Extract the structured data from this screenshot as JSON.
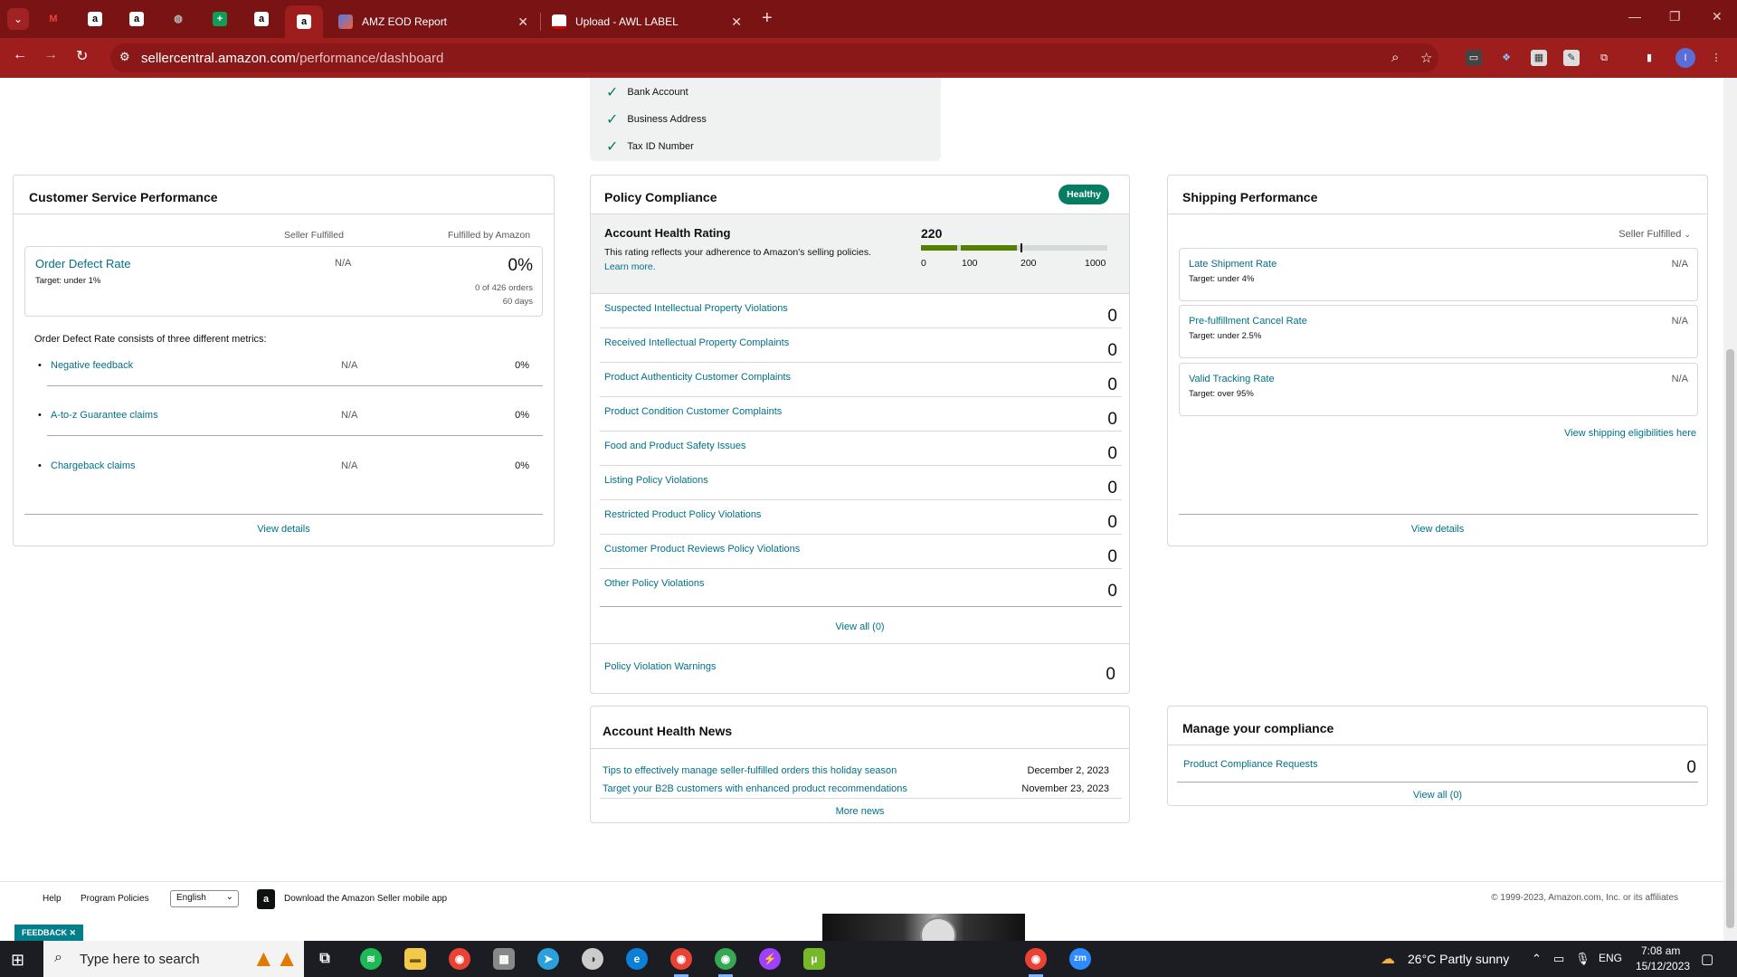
{
  "browser": {
    "tabs": [
      {
        "title": "AMZ EOD Report"
      },
      {
        "title": "Upload - AWL LABEL"
      }
    ],
    "url_host": "sellercentral.amazon.com",
    "url_path": "/performance/dashboard"
  },
  "verification": {
    "items": [
      "Bank Account",
      "Business Address",
      "Tax ID Number"
    ]
  },
  "customer_service": {
    "title": "Customer Service Performance",
    "col_seller": "Seller Fulfilled",
    "col_amazon": "Fulfilled by Amazon",
    "odr": {
      "label": "Order Defect Rate",
      "target": "Target: under 1%",
      "seller_value": "N/A",
      "amazon_value": "0%",
      "amazon_orders": "0 of 426 orders",
      "amazon_period": "60 days"
    },
    "consists_text": "Order Defect Rate consists of three different metrics:",
    "metrics": [
      {
        "label": "Negative feedback",
        "seller": "N/A",
        "amazon": "0%"
      },
      {
        "label": "A-to-z Guarantee claims",
        "seller": "N/A",
        "amazon": "0%"
      },
      {
        "label": "Chargeback claims",
        "seller": "N/A",
        "amazon": "0%"
      }
    ],
    "view_details": "View details"
  },
  "policy": {
    "title": "Policy Compliance",
    "badge": "Healthy",
    "ahr_title": "Account Health Rating",
    "ahr_desc": "This rating reflects your adherence to Amazon's selling policies.",
    "learn_more": "Learn more.",
    "score": "220",
    "score_value": 220,
    "scale_labels": [
      "0",
      "100",
      "200",
      "1000"
    ],
    "violations": [
      {
        "label": "Suspected Intellectual Property Violations",
        "count": "0"
      },
      {
        "label": "Received Intellectual Property Complaints",
        "count": "0"
      },
      {
        "label": "Product Authenticity Customer Complaints",
        "count": "0"
      },
      {
        "label": "Product Condition Customer Complaints",
        "count": "0"
      },
      {
        "label": "Food and Product Safety Issues",
        "count": "0"
      },
      {
        "label": "Listing Policy Violations",
        "count": "0"
      },
      {
        "label": "Restricted Product Policy Violations",
        "count": "0"
      },
      {
        "label": "Customer Product Reviews Policy Violations",
        "count": "0"
      },
      {
        "label": "Other Policy Violations",
        "count": "0"
      }
    ],
    "view_all": "View all (0)",
    "warnings_label": "Policy Violation Warnings",
    "warnings_count": "0"
  },
  "news": {
    "title": "Account Health News",
    "items": [
      {
        "label": "Tips to effectively manage seller-fulfilled orders this holiday season",
        "date": "December 2, 2023"
      },
      {
        "label": "Target your B2B customers with enhanced product recommendations",
        "date": "November 23, 2023"
      }
    ],
    "more": "More news"
  },
  "shipping": {
    "title": "Shipping Performance",
    "dropdown": "Seller Fulfilled",
    "metrics": [
      {
        "label": "Late Shipment Rate",
        "target": "Target: under 4%",
        "value": "N/A"
      },
      {
        "label": "Pre-fulfillment Cancel Rate",
        "target": "Target: under 2.5%",
        "value": "N/A"
      },
      {
        "label": "Valid Tracking Rate",
        "target": "Target: over 95%",
        "value": "N/A"
      }
    ],
    "eligibility_link": "View shipping eligibilities here",
    "view_details": "View details"
  },
  "compliance": {
    "title": "Manage your compliance",
    "label": "Product Compliance Requests",
    "count": "0",
    "view_all": "View all (0)"
  },
  "footer": {
    "help": "Help",
    "program_policies": "Program Policies",
    "language": "English",
    "app": "Download the Amazon Seller mobile app",
    "copyright": "© 1999-2023, Amazon.com, Inc. or its affiliates",
    "feedback": "FEEDBACK"
  },
  "taskbar": {
    "search_placeholder": "Type here to search",
    "weather": "26°C  Partly sunny",
    "lang": "ENG",
    "time": "7:08 am",
    "date": "15/12/2023"
  },
  "colors": {
    "chrome": "#7a1414",
    "toolbar": "#9e1d1d",
    "link": "#007185",
    "healthy": "#067d62",
    "bar_green": "#538000"
  }
}
